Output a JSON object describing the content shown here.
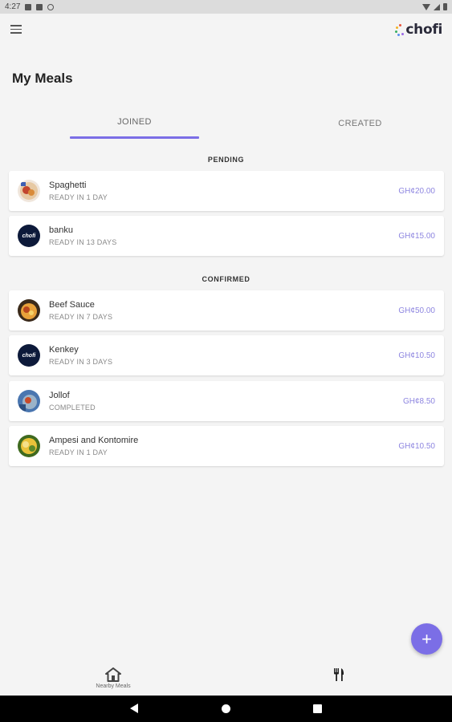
{
  "status_bar": {
    "time": "4:27"
  },
  "app": {
    "logo_text": "chofi"
  },
  "page": {
    "title": "My Meals"
  },
  "tabs": {
    "joined": "JOINED",
    "created": "CREATED"
  },
  "sections": {
    "pending": "PENDING",
    "confirmed": "CONFIRMED"
  },
  "pending": [
    {
      "name": "Spaghetti",
      "status": "READY IN 1 DAY",
      "price": "GH¢20.00",
      "avatar": "photo"
    },
    {
      "name": "banku",
      "status": "READY IN 13 DAYS",
      "price": "GH¢15.00",
      "avatar": "chofi-logo"
    }
  ],
  "confirmed": [
    {
      "name": "Beef Sauce",
      "status": "READY IN 7 DAYS",
      "price": "GH¢50.00",
      "avatar": "photo"
    },
    {
      "name": "Kenkey",
      "status": "READY IN 3 DAYS",
      "price": "GH¢10.50",
      "avatar": "chofi-logo"
    },
    {
      "name": "Jollof",
      "status": "COMPLETED",
      "price": "GH¢8.50",
      "avatar": "photo"
    },
    {
      "name": "Ampesi and Kontomire",
      "status": "READY IN 1 DAY",
      "price": "GH¢10.50",
      "avatar": "photo"
    }
  ],
  "bottom_nav": {
    "home_label": "Nearby Meals"
  },
  "avatar_logo_text": "chofi",
  "colors": {
    "accent": "#7b6ee6",
    "price": "#8e86e0"
  },
  "icons": {
    "menu": "hamburger-icon",
    "home": "home-icon",
    "meals": "fork-knife-icon",
    "fab": "plus-icon"
  }
}
